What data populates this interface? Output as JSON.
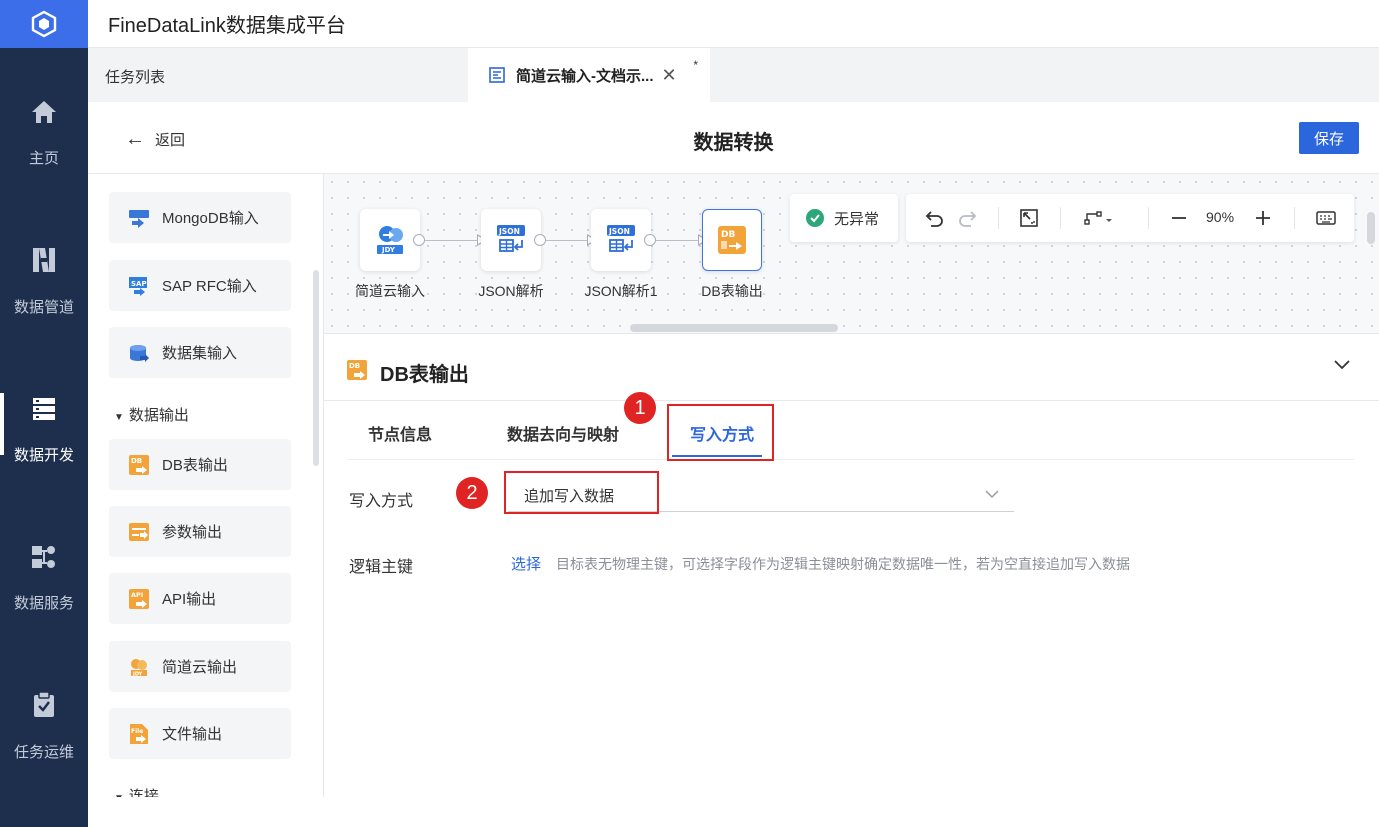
{
  "app": {
    "title": "FineDataLink数据集成平台"
  },
  "rail": {
    "items": [
      {
        "label": "主页",
        "icon": "home-icon"
      },
      {
        "label": "数据管道",
        "icon": "pipeline-icon"
      },
      {
        "label": "数据开发",
        "icon": "develop-icon",
        "active": true
      },
      {
        "label": "数据服务",
        "icon": "service-icon"
      },
      {
        "label": "任务运维",
        "icon": "ops-icon"
      }
    ]
  },
  "tabs": {
    "list_label": "任务列表",
    "active_label": "简道云输入-文档示...",
    "active_modified_mark": "*"
  },
  "header": {
    "back_label": "返回",
    "title": "数据转换",
    "save_label": "保存"
  },
  "palette": {
    "items_top": [
      {
        "label": "MongoDB输入",
        "icon": "mongodb-icon"
      },
      {
        "label": "SAP RFC输入",
        "icon": "sap-icon"
      },
      {
        "label": "数据集输入",
        "icon": "dataset-icon"
      }
    ],
    "group_output": "数据输出",
    "items_output": [
      {
        "label": "DB表输出",
        "icon": "db-output-icon"
      },
      {
        "label": "参数输出",
        "icon": "param-output-icon"
      },
      {
        "label": "API输出",
        "icon": "api-output-icon"
      },
      {
        "label": "简道云输出",
        "icon": "jdy-output-icon"
      },
      {
        "label": "文件输出",
        "icon": "file-output-icon"
      }
    ],
    "group_connect": "连接"
  },
  "canvas": {
    "nodes": [
      {
        "label": "简道云输入",
        "icon": "jdy-input-icon"
      },
      {
        "label": "JSON解析",
        "icon": "json-parse-icon"
      },
      {
        "label": "JSON解析1",
        "icon": "json-parse-icon"
      },
      {
        "label": "DB表输出",
        "icon": "db-output-icon",
        "selected": true
      }
    ],
    "status_label": "无异常",
    "zoom": "90%",
    "colors": {
      "accent": "#2b66dc",
      "ok": "#2ca77a"
    }
  },
  "panel": {
    "title": "DB表输出",
    "tabs": [
      {
        "label": "节点信息"
      },
      {
        "label": "数据去向与映射"
      },
      {
        "label": "写入方式",
        "active": true
      }
    ],
    "write_mode_label": "写入方式",
    "write_mode_value": "追加写入数据",
    "logic_key_label": "逻辑主键",
    "logic_key_link": "选择",
    "logic_key_hint": "目标表无物理主键，可选择字段作为逻辑主键映射确定数据唯一性，若为空直接追加写入数据"
  },
  "annotations": {
    "badge1": "1",
    "badge2": "2",
    "color": "#e02424"
  }
}
